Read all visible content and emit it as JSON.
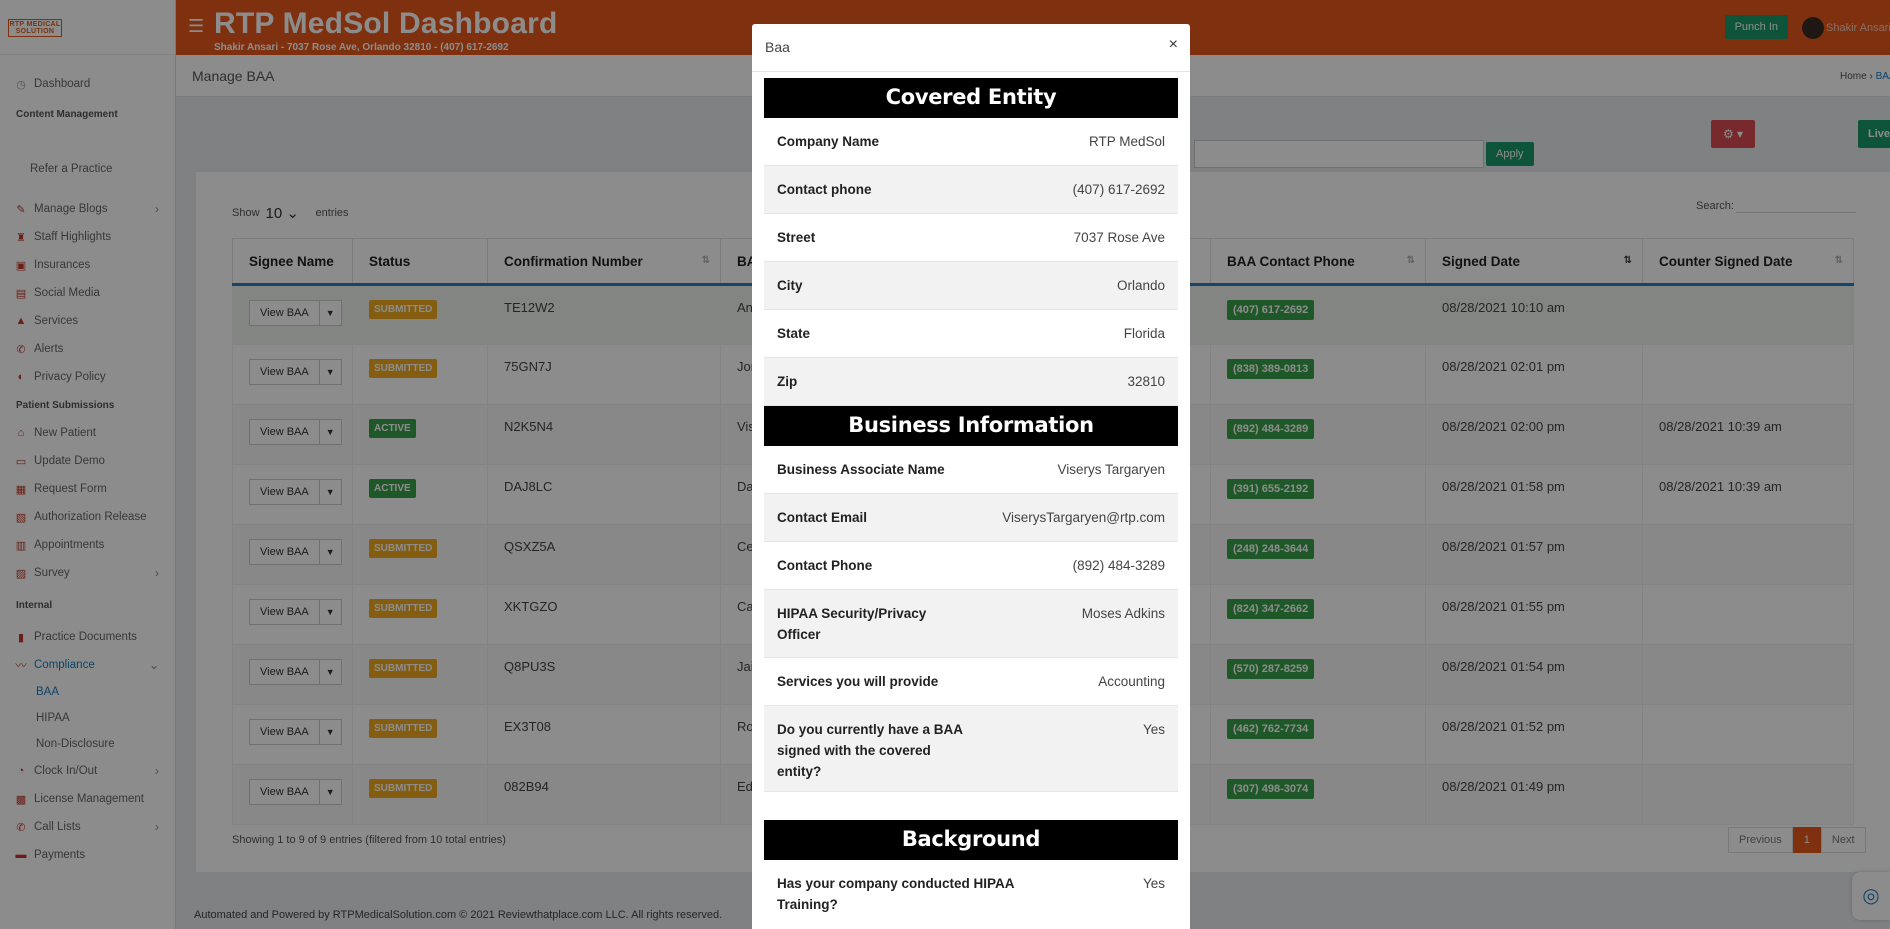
{
  "sidebar": {
    "logo": "RTP MEDICAL SOLUTION",
    "items": [
      {
        "label": "Dashboard",
        "icon": "gauge-icon"
      },
      {
        "header": "Content Management"
      },
      {
        "label": "Refer a Practice"
      },
      {
        "label": "Manage Blogs",
        "icon": "blog-icon"
      },
      {
        "label": "Staff Highlights",
        "icon": "star-icon"
      },
      {
        "label": "Insurances",
        "icon": "shield-icon"
      },
      {
        "label": "Social Media",
        "icon": "share-icon"
      },
      {
        "label": "Services",
        "icon": "hand-icon"
      },
      {
        "label": "Alerts",
        "icon": "phone-icon"
      },
      {
        "label": "Privacy Policy",
        "icon": "shield-icon"
      },
      {
        "header": "Patient Submissions"
      },
      {
        "label": "New Patient",
        "icon": "home-icon"
      },
      {
        "label": "Update Demo",
        "icon": "id-card-icon"
      },
      {
        "label": "Request Form",
        "icon": "form-icon"
      },
      {
        "label": "Authorization Release",
        "icon": "release-icon"
      },
      {
        "label": "Appointments",
        "icon": "calendar-icon"
      },
      {
        "label": "Survey",
        "icon": "chart-icon"
      },
      {
        "header": "Internal"
      },
      {
        "label": "Practice Documents",
        "icon": "document-icon"
      },
      {
        "label": "Compliance",
        "icon": "pulse-icon"
      },
      {
        "sub": "BAA"
      },
      {
        "sub": "HIPAA"
      },
      {
        "sub": "Non-Disclosure"
      },
      {
        "label": "Clock In/Out",
        "icon": "clock-icon"
      },
      {
        "label": "License Management",
        "icon": "license-icon"
      },
      {
        "label": "Call Lists",
        "icon": "phone-icon"
      },
      {
        "label": "Payments",
        "icon": "money-icon"
      }
    ]
  },
  "topbar": {
    "title": "RTP MedSol Dashboard",
    "subtitle": "Shakir Ansari - 7037 Rose Ave, Orlando 32810 - (407) 617-2692",
    "punch_label": "Punch In",
    "user": "Shakir Ansari"
  },
  "page": {
    "title": "Manage BAA",
    "breadcrumb_home": "Home",
    "breadcrumb_current": "BAA",
    "apply_label": "Apply",
    "live_label": "Live"
  },
  "table": {
    "show_label": "Show",
    "show_value": "10",
    "entries_label": "entries",
    "search_label": "Search:",
    "headers": [
      "Signee Name",
      "Status",
      "Confirmation Number",
      "BAA",
      "BAA Contact Phone",
      "Signed Date",
      "Counter Signed Date"
    ],
    "view_label": "View BAA",
    "rows": [
      {
        "status": "SUBMITTED",
        "conf": "TE12W2",
        "baa": "Ans",
        "phone": "(407) 617-2692",
        "signed": "08/28/2021 10:10 am",
        "counter": ""
      },
      {
        "status": "SUBMITTED",
        "conf": "75GN7J",
        "baa": "Jor",
        "phone": "(838) 389-0813",
        "signed": "08/28/2021 02:01 pm",
        "counter": ""
      },
      {
        "status": "ACTIVE",
        "conf": "N2K5N4",
        "baa": "Vis",
        "phone": "(892) 484-3289",
        "signed": "08/28/2021 02:00 pm",
        "counter": "08/28/2021 10:39 am"
      },
      {
        "status": "ACTIVE",
        "conf": "DAJ8LC",
        "baa": "Dae",
        "phone": "(391) 655-2192",
        "signed": "08/28/2021 01:58 pm",
        "counter": "08/28/2021 10:39 am"
      },
      {
        "status": "SUBMITTED",
        "conf": "QSXZ5A",
        "baa": "Cer",
        "phone": "(248) 248-3644",
        "signed": "08/28/2021 01:57 pm",
        "counter": ""
      },
      {
        "status": "SUBMITTED",
        "conf": "XKTGZO",
        "baa": "Cat",
        "phone": "(824) 347-2662",
        "signed": "08/28/2021 01:55 pm",
        "counter": ""
      },
      {
        "status": "SUBMITTED",
        "conf": "Q8PU3S",
        "baa": "Jai",
        "phone": "(570) 287-8259",
        "signed": "08/28/2021 01:54 pm",
        "counter": ""
      },
      {
        "status": "SUBMITTED",
        "conf": "EX3T08",
        "baa": "Rob",
        "phone": "(462) 762-7734",
        "signed": "08/28/2021 01:52 pm",
        "counter": ""
      },
      {
        "status": "SUBMITTED",
        "conf": "082B94",
        "baa": "Edd",
        "phone": "(307) 498-3074",
        "signed": "08/28/2021 01:49 pm",
        "counter": ""
      }
    ],
    "info": "Showing 1 to 9 of 9 entries (filtered from 10 total entries)",
    "pager": {
      "prev": "Previous",
      "current": "1",
      "next": "Next"
    }
  },
  "footer": "Automated and Powered by RTPMedicalSolution.com © 2021 Reviewthatplace.com LLC. All rights reserved.",
  "modal": {
    "title": "Baa",
    "close": "×",
    "sections": [
      {
        "title": "Covered Entity",
        "rows": [
          {
            "k": "Company Name",
            "v": "RTP MedSol"
          },
          {
            "k": "Contact phone",
            "v": "(407) 617-2692"
          },
          {
            "k": "Street",
            "v": "7037 Rose Ave"
          },
          {
            "k": "City",
            "v": "Orlando"
          },
          {
            "k": "State",
            "v": "Florida"
          },
          {
            "k": "Zip",
            "v": "32810"
          }
        ]
      },
      {
        "title": "Business Information",
        "rows": [
          {
            "k": "Business Associate Name",
            "v": "Viserys Targaryen"
          },
          {
            "k": "Contact Email",
            "v": "ViserysTargaryen@rtp.com"
          },
          {
            "k": "Contact Phone",
            "v": "(892) 484-3289"
          },
          {
            "k": "HIPAA Security/Privacy Officer",
            "v": "Moses Adkins"
          },
          {
            "k": "Services you will provide",
            "v": "Accounting"
          },
          {
            "k": "Do you currently have a BAA signed with the covered entity?",
            "v": "Yes"
          }
        ]
      },
      {
        "title": "Background",
        "rows": [
          {
            "k": "Has your company conducted HIPAA Training?",
            "v": "Yes"
          }
        ]
      }
    ]
  },
  "colors": {
    "brand": "#e85a1d",
    "green": "#1a9a6b",
    "submitted": "#f0a91e",
    "active": "#3aa14a"
  }
}
